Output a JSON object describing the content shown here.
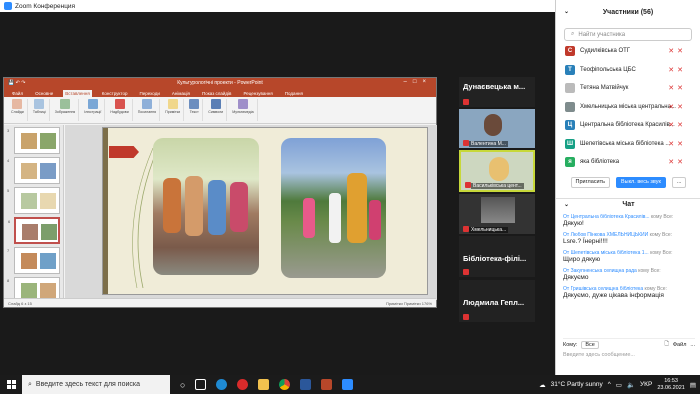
{
  "zoom": {
    "title": "Zoom Конференция"
  },
  "ppt": {
    "title": "Культурологічні проекти - PowerPoint",
    "tabs": [
      "Файл",
      "Основне",
      "Вставлення",
      "Конструктор",
      "Переходи",
      "Анімація",
      "Показ слайдів",
      "Рецензування",
      "Подання"
    ],
    "active_tab": "Вставлення",
    "ribbon_groups": [
      "Слайди",
      "Таблиці",
      "Зображення",
      "Ілюстрації",
      "Надбудови",
      "Посилання",
      "Примітки",
      "Текст",
      "Символи",
      "Мультимедіа"
    ],
    "status_left": "Слайд 6 з 15",
    "status_right": "Примітки   Примітки   176%"
  },
  "tiles": [
    {
      "name": "Дунаєвецька м...",
      "label": ""
    },
    {
      "name": "",
      "label": "Валентина М..."
    },
    {
      "name": "",
      "label": "Васильківська цент..."
    },
    {
      "name": "",
      "label": "Хмельницька..."
    },
    {
      "name": "Бібліотека-філі...",
      "label": ""
    },
    {
      "name": "Людмила  Гепл...",
      "label": ""
    }
  ],
  "participants": {
    "header": "Участники (56)",
    "search_placeholder": "Найти участника",
    "items": [
      {
        "initial": "С",
        "name": "Судилківська ОТГ",
        "color": "#c0392b"
      },
      {
        "initial": "Т",
        "name": "Теофіпольська ЦБС",
        "color": "#2980b9"
      },
      {
        "initial": "",
        "name": "Тетяна Матвійчук",
        "color": "#bbbbbb"
      },
      {
        "initial": "",
        "name": "Хмельницька міська центральна...",
        "color": "#7f8c8d"
      },
      {
        "initial": "Ц",
        "name": "Центральна бібліотека Красилів...",
        "color": "#2980b9"
      },
      {
        "initial": "Ш",
        "name": "Шепетівська міська бібліотека ...",
        "color": "#16a085"
      },
      {
        "initial": "я",
        "name": "яка бібліотека",
        "color": "#27ae60"
      }
    ],
    "invite_label": "Пригласить",
    "mute_all_label": "Выкл. весь звук",
    "more_label": "..."
  },
  "chat": {
    "header": "Чат",
    "messages": [
      {
        "from": "От Центральна бібліотека Красилів...",
        "to": "кому Все:",
        "text": "Дякую!"
      },
      {
        "from": "От Любов Пінкова ХМЕЛЬНИЦЬКИЙ",
        "to": "кому Все:",
        "text": "Lsre.? Їнерні!!!!"
      },
      {
        "from": "От Шепетівська міська бібліотека 1...",
        "to": "кому Все:",
        "text": "Щиро дякую"
      },
      {
        "from": "От Закупненська селищна рада",
        "to": "кому Все:",
        "text": "Дякуємо"
      },
      {
        "from": "От Гришівська селищна бібліотека",
        "to": "кому Все:",
        "text": "Дякуємо, дуже цікава інформація"
      }
    ],
    "to_label": "Кому:",
    "to_value": "Все",
    "file_label": "Файл",
    "more_label": "...",
    "input_placeholder": "Введите здесь сообщение..."
  },
  "taskbar": {
    "search_placeholder": "Введите здесь текст для поиска",
    "weather": "31°C  Partly sunny",
    "lang": "УКР",
    "time": "16:53",
    "date": "23.06.2021"
  }
}
